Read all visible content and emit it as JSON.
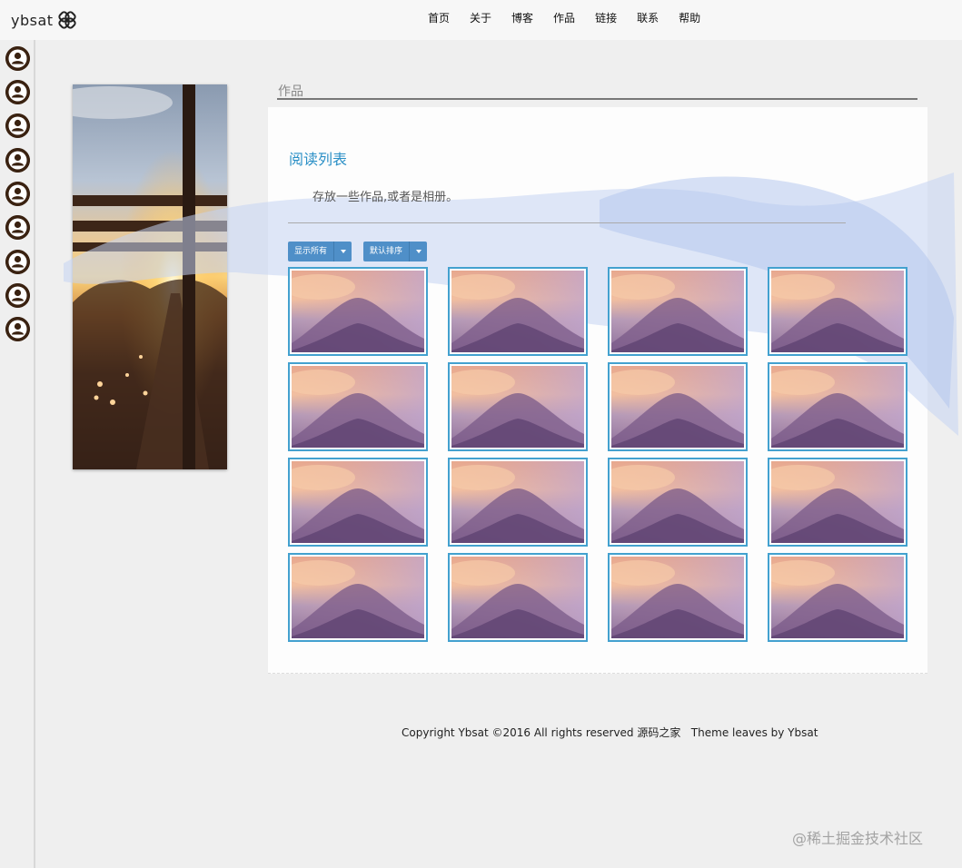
{
  "topbar": {
    "logo_text": "ybsat",
    "nav": [
      "首页",
      "关于",
      "博客",
      "作品",
      "链接",
      "联系",
      "帮助"
    ]
  },
  "sidebar": {
    "avatar_icon": "user-avatar-icon",
    "avatar_count": 9
  },
  "section": {
    "title": "作品"
  },
  "panel": {
    "heading": "阅读列表",
    "description": "存放一些作品,或者是相册。",
    "filter_label": "显示所有",
    "sort_label": "默认排序"
  },
  "gallery": {
    "count": 16,
    "columns": 4
  },
  "footer": {
    "text": "Copyright Ybsat ©2016 All rights reserved 源码之家   Theme leaves by Ybsat"
  },
  "watermark": {
    "text": "@稀土掘金技术社区"
  },
  "colors": {
    "accent": "#2a8fc6",
    "button": "#4f8fc8",
    "thumb_border": "#43a1cf",
    "avatar": "#3a2211"
  }
}
